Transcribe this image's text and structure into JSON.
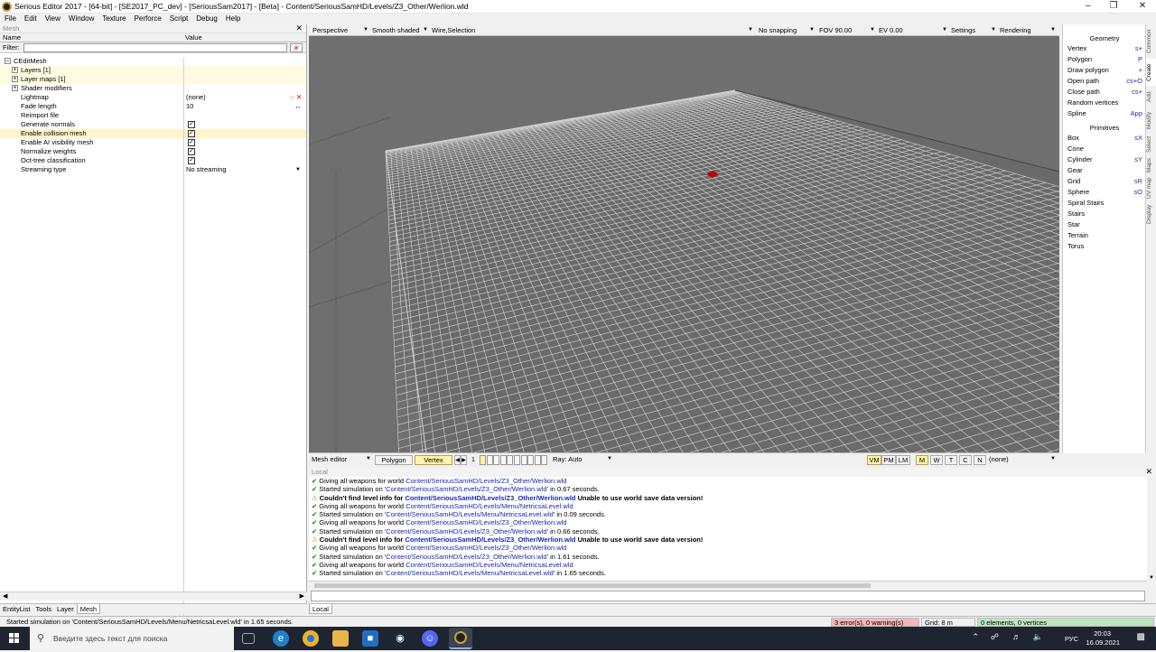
{
  "window": {
    "title": "Serious Editor 2017 - [64-bit] - [SE2017_PC_dev] - [SeriousSam2017] - [Beta] - Content/SeriousSamHD/Levels/Z3_Other/Werlion.wld"
  },
  "menu": [
    "File",
    "Edit",
    "View",
    "Window",
    "Texture",
    "Perforce",
    "Script",
    "Debug",
    "Help"
  ],
  "left_panel": {
    "title": "Mesh",
    "col_name": "Name",
    "col_value": "Value",
    "filter_label": "Filter:",
    "root": "CEditMesh",
    "groups": [
      "Layers [1]",
      "Layer maps [1]",
      "Shader modifiers"
    ],
    "props": [
      {
        "name": "Lightmap",
        "value": "(none)"
      },
      {
        "name": "Fade length",
        "value": "10"
      },
      {
        "name": "Reimport file",
        "value": ""
      },
      {
        "name": "Generate normals",
        "value": "✓"
      },
      {
        "name": "Enable collision mesh",
        "value": "✓"
      },
      {
        "name": "Enable AI visibility mesh",
        "value": "✓"
      },
      {
        "name": "Normalize weights",
        "value": "✓"
      },
      {
        "name": "Oct-tree classification",
        "value": "✓"
      },
      {
        "name": "Streaming type",
        "value": "No streaming"
      }
    ],
    "tabs": [
      "EntityList",
      "Tools",
      "Layer",
      "Mesh"
    ]
  },
  "viewport_toolbar": {
    "projection": "Perspective",
    "shading": "Smooth shaded",
    "overlay": "Wire,Selection",
    "snapping": "No snapping",
    "fov": "FOV 90.00",
    "ev": "EV  0.00",
    "settings": "Settings",
    "rendering": "Rendering"
  },
  "viewport_bottom": {
    "mode": "Mesh editor",
    "polygon": "Polygon",
    "vertex": "Vertex",
    "index": "1",
    "ray": "Ray: Auto",
    "toggles": [
      "VM",
      "PM",
      "LM",
      "M",
      "W",
      "T",
      "C",
      "N"
    ],
    "none": "(none)"
  },
  "right_panel": {
    "geometry_title": "Geometry",
    "geometry": [
      {
        "label": "Vertex",
        "key": "s+"
      },
      {
        "label": "Polygon",
        "key": "P"
      },
      {
        "label": "Draw polygon",
        "key": "+"
      },
      {
        "label": "Open path",
        "key": "cs+O"
      },
      {
        "label": "Close path",
        "key": "cs+"
      },
      {
        "label": "Random vertices",
        "key": ""
      },
      {
        "label": "Spline",
        "key": "App"
      }
    ],
    "primitives_title": "Primitives",
    "primitives": [
      {
        "label": "Box",
        "key": "sX"
      },
      {
        "label": "Cone",
        "key": ""
      },
      {
        "label": "Cylinder",
        "key": "sY"
      },
      {
        "label": "Gear",
        "key": ""
      },
      {
        "label": "Grid",
        "key": "sR"
      },
      {
        "label": "Sphere",
        "key": "sO"
      },
      {
        "label": "Spiral Stairs",
        "key": ""
      },
      {
        "label": "Stairs",
        "key": ""
      },
      {
        "label": "Star",
        "key": ""
      },
      {
        "label": "Terrain",
        "key": ""
      },
      {
        "label": "Torus",
        "key": ""
      }
    ],
    "vtabs": [
      "Common",
      "Create",
      "Add",
      "Modify",
      "Select",
      "Maps",
      "UV map",
      "Display"
    ]
  },
  "log": {
    "title": "Local",
    "lines": [
      {
        "kind": "ok",
        "pre": "Giving all weapons for world ",
        "link": "Content/SeriousSamHD/Levels/Z3_Other/Werlion.wld",
        "post": ""
      },
      {
        "kind": "ok",
        "pre": "Started simulation on '",
        "link": "Content/SeriousSamHD/Levels/Z3_Other/Werlion.wld",
        "post": "' in 0.67 seconds."
      },
      {
        "kind": "warn",
        "pre": "Couldn't find level info for ",
        "link": "Content/SeriousSamHD/Levels/Z3_Other/Werlion.wld",
        "post": " Unable to use world save data version!",
        "bold": true
      },
      {
        "kind": "ok",
        "pre": "Giving all weapons for world ",
        "link": "Content/SeriousSamHD/Levels/Menu/NetricsaLevel.wld",
        "post": ""
      },
      {
        "kind": "ok",
        "pre": "Started simulation on '",
        "link": "Content/SeriousSamHD/Levels/Menu/NetricsaLevel.wld",
        "post": "' in 0.09 seconds."
      },
      {
        "kind": "ok",
        "pre": "Giving all weapons for world ",
        "link": "Content/SeriousSamHD/Levels/Z3_Other/Werlion.wld",
        "post": ""
      },
      {
        "kind": "ok",
        "pre": "Started simulation on '",
        "link": "Content/SeriousSamHD/Levels/Z3_Other/Werlion.wld",
        "post": "' in 0.66 seconds."
      },
      {
        "kind": "warn",
        "pre": "Couldn't find level info for ",
        "link": "Content/SeriousSamHD/Levels/Z3_Other/Werlion.wld",
        "post": " Unable to use world save data version!",
        "bold": true
      },
      {
        "kind": "ok",
        "pre": "Giving all weapons for world ",
        "link": "Content/SeriousSamHD/Levels/Z3_Other/Werlion.wld",
        "post": ""
      },
      {
        "kind": "ok",
        "pre": "Started simulation on '",
        "link": "Content/SeriousSamHD/Levels/Z3_Other/Werlion.wld",
        "post": "' in 1.61 seconds."
      },
      {
        "kind": "ok",
        "pre": "Giving all weapons for world ",
        "link": "Content/SeriousSamHD/Levels/Menu/NetricsaLevel.wld",
        "post": ""
      },
      {
        "kind": "ok",
        "pre": "Started simulation on '",
        "link": "Content/SeriousSamHD/Levels/Menu/NetricsaLevel.wld",
        "post": "' in 1.65 seconds."
      }
    ],
    "tab": "Local"
  },
  "status": {
    "message": "Started simulation on 'Content/SeriousSamHD/Levels/Menu/NetricsaLevel.wld' in 1.65 seconds.",
    "errors": "3 error(s), 0 warning(s)",
    "grid": "Grid: 8 m",
    "elements": "0 elements, 0 vertices"
  },
  "taskbar": {
    "search_placeholder": "Введите здесь текст для поиска",
    "lang": "РУС",
    "time": "20:03",
    "date": "16.09.2021"
  },
  "colors": {
    "viewport_bg": "#6f6f6f",
    "grid_line": "#d8d8d8",
    "selection": "#c00000",
    "accent_yellow": "#fff3a8"
  }
}
